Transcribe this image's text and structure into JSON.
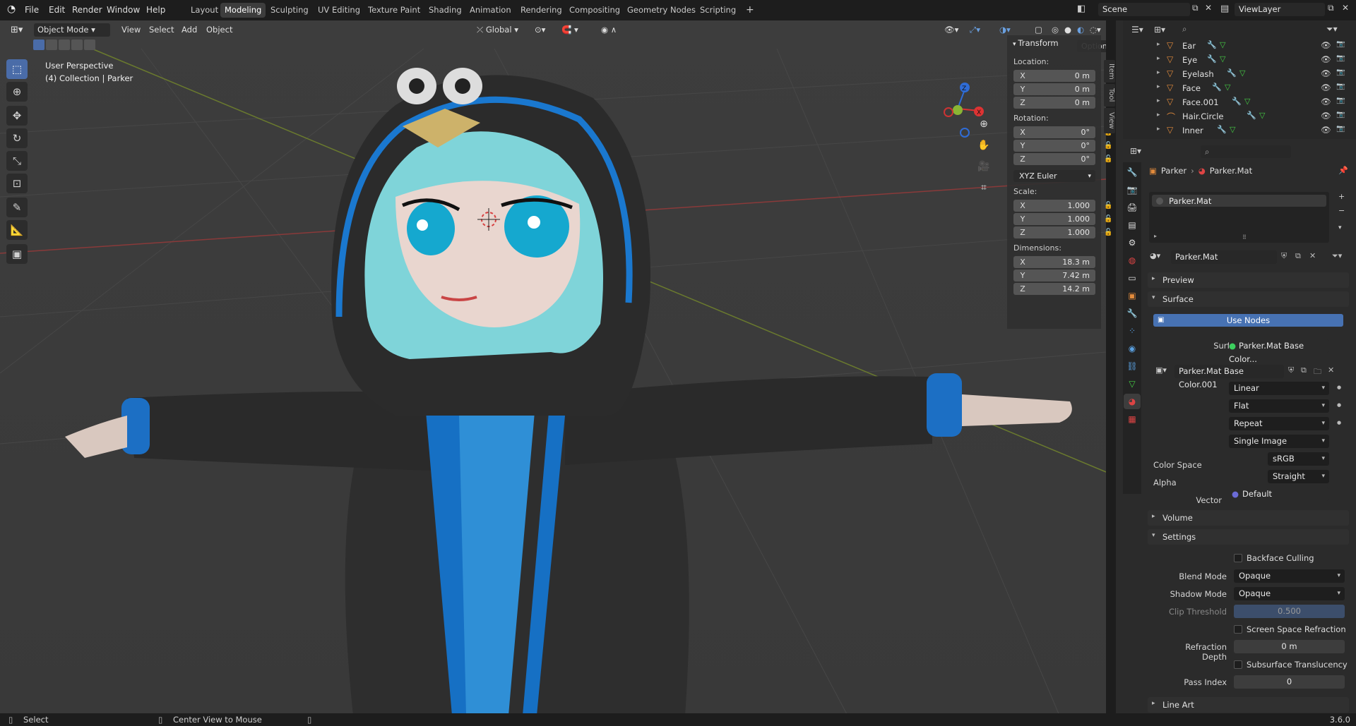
{
  "topbar": {
    "menus": [
      "File",
      "Edit",
      "Render",
      "Window",
      "Help"
    ],
    "workspaces": [
      "Layout",
      "Modeling",
      "Sculpting",
      "UV Editing",
      "Texture Paint",
      "Shading",
      "Animation",
      "Rendering",
      "Compositing",
      "Geometry Nodes",
      "Scripting"
    ],
    "active_workspace": "Modeling",
    "add_tab": "+",
    "scene": "Scene",
    "view_layer": "ViewLayer"
  },
  "viewport_header": {
    "mode": "Object Mode",
    "menus": [
      "View",
      "Select",
      "Add",
      "Object"
    ],
    "orientation": "Global",
    "options": "Options"
  },
  "viewport_overlay": {
    "perspective": "User Perspective",
    "collection": "(4) Collection | Parker"
  },
  "gizmo": {
    "x": "X",
    "y": "Y",
    "z": "Z"
  },
  "transform_panel": {
    "title": "Transform",
    "location_label": "Location:",
    "location": [
      {
        "ax": "X",
        "v": "0 m"
      },
      {
        "ax": "Y",
        "v": "0 m"
      },
      {
        "ax": "Z",
        "v": "0 m"
      }
    ],
    "rotation_label": "Rotation:",
    "rotation": [
      {
        "ax": "X",
        "v": "0°"
      },
      {
        "ax": "Y",
        "v": "0°"
      },
      {
        "ax": "Z",
        "v": "0°"
      }
    ],
    "rotation_mode": "XYZ Euler",
    "scale_label": "Scale:",
    "scale": [
      {
        "ax": "X",
        "v": "1.000"
      },
      {
        "ax": "Y",
        "v": "1.000"
      },
      {
        "ax": "Z",
        "v": "1.000"
      }
    ],
    "dimensions_label": "Dimensions:",
    "dimensions": [
      {
        "ax": "X",
        "v": "18.3 m"
      },
      {
        "ax": "Y",
        "v": "7.42 m"
      },
      {
        "ax": "Z",
        "v": "14.2 m"
      }
    ]
  },
  "npanel_tabs": [
    "Item",
    "Tool",
    "View"
  ],
  "outliner": {
    "items": [
      "Ear",
      "Eye",
      "Eyelash",
      "Face",
      "Face.001",
      "Hair.Circle",
      "Inner"
    ]
  },
  "properties": {
    "breadcrumb_object": "Parker",
    "breadcrumb_material": "Parker.Mat",
    "slot": "Parker.Mat",
    "material_name": "Parker.Mat",
    "sections": {
      "preview": "Preview",
      "surface": "Surface",
      "volume": "Volume",
      "settings": "Settings",
      "line_art": "Line Art"
    },
    "use_nodes": "Use Nodes",
    "surface_label": "Surface",
    "surface_value": "Parker.Mat Base Color...",
    "image_name": "Parker.Mat Base Color.001",
    "interpolation": "Linear",
    "projection": "Flat",
    "extension": "Repeat",
    "source": "Single Image",
    "color_space_label": "Color Space",
    "color_space": "sRGB",
    "alpha_label": "Alpha",
    "alpha": "Straight",
    "vector_label": "Vector",
    "vector": "Default",
    "backface_culling": "Backface Culling",
    "blend_mode_label": "Blend Mode",
    "blend_mode": "Opaque",
    "shadow_mode_label": "Shadow Mode",
    "shadow_mode": "Opaque",
    "clip_threshold_label": "Clip Threshold",
    "clip_threshold": "0.500",
    "ssr": "Screen Space Refraction",
    "refraction_depth_label": "Refraction Depth",
    "refraction_depth": "0 m",
    "subsurface": "Subsurface Translucency",
    "pass_index_label": "Pass Index",
    "pass_index": "0"
  },
  "status": {
    "select": "Select",
    "center": "Center View to Mouse",
    "version": "3.6.0"
  }
}
